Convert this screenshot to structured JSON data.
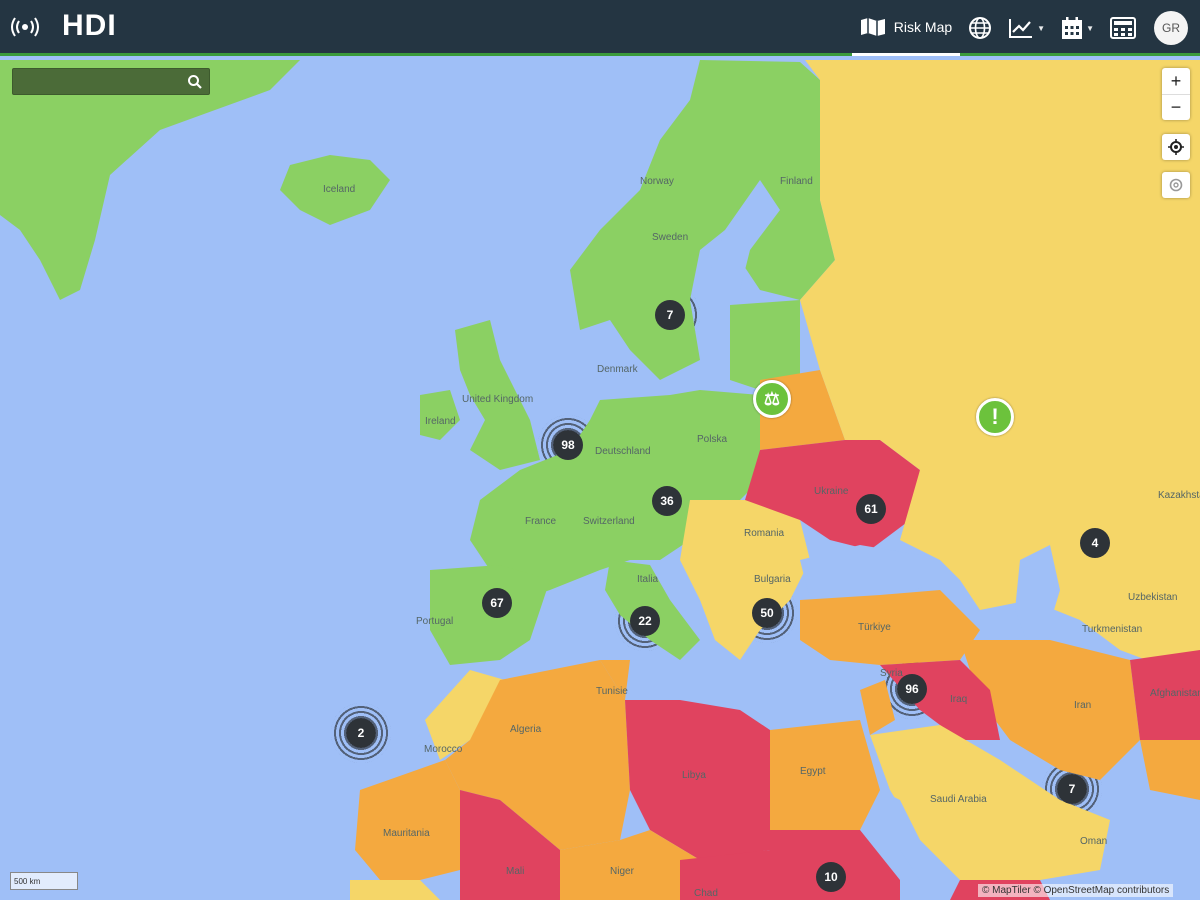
{
  "header": {
    "logo": "HDI",
    "nav": [
      {
        "id": "risk-map",
        "label": "Risk Map",
        "icon": "map-icon",
        "active": true
      },
      {
        "id": "globe",
        "label": "",
        "icon": "globe-icon"
      },
      {
        "id": "charts",
        "label": "",
        "icon": "line-chart-icon",
        "dropdown": true
      },
      {
        "id": "calendar",
        "label": "",
        "icon": "calendar-icon",
        "dropdown": true
      },
      {
        "id": "calculator",
        "label": "",
        "icon": "calculator-icon"
      }
    ],
    "user_initials": "GR"
  },
  "search": {
    "placeholder": "",
    "value": ""
  },
  "controls": {
    "zoom_in": "+",
    "zoom_out": "−"
  },
  "map": {
    "legend_colors": {
      "green": "#8bd063",
      "yellow": "#f5d668",
      "orange": "#f4a93f",
      "red": "#e0435f",
      "water": "#9fbff7"
    },
    "country_labels": [
      {
        "name": "Iceland"
      },
      {
        "name": "Norway"
      },
      {
        "name": "Sweden"
      },
      {
        "name": "Finland"
      },
      {
        "name": "Denmark"
      },
      {
        "name": "United Kingdom"
      },
      {
        "name": "Ireland"
      },
      {
        "name": "Deutschland"
      },
      {
        "name": "Polska"
      },
      {
        "name": "France"
      },
      {
        "name": "Switzerland"
      },
      {
        "name": "Portugal"
      },
      {
        "name": "Italia"
      },
      {
        "name": "Romania"
      },
      {
        "name": "Ukraine"
      },
      {
        "name": "Bulgaria"
      },
      {
        "name": "Türkiye"
      },
      {
        "name": "Tunisie"
      },
      {
        "name": "Algeria"
      },
      {
        "name": "Libya"
      },
      {
        "name": "Egypt"
      },
      {
        "name": "Morocco"
      },
      {
        "name": "Mauritania"
      },
      {
        "name": "Mali"
      },
      {
        "name": "Niger"
      },
      {
        "name": "Chad"
      },
      {
        "name": "Saudi Arabia"
      },
      {
        "name": "Iraq"
      },
      {
        "name": "Iran"
      },
      {
        "name": "Afghanistan"
      },
      {
        "name": "Kazakhstan"
      },
      {
        "name": "Uzbekistan"
      },
      {
        "name": "Turkmenistan"
      },
      {
        "name": "Oman"
      },
      {
        "name": "Syria"
      }
    ],
    "clusters": [
      {
        "count": "7"
      },
      {
        "count": "98"
      },
      {
        "count": "36"
      },
      {
        "count": "61"
      },
      {
        "count": "4"
      },
      {
        "count": "67"
      },
      {
        "count": "22"
      },
      {
        "count": "50"
      },
      {
        "count": "2"
      },
      {
        "count": "96"
      },
      {
        "count": "7"
      },
      {
        "count": "10"
      }
    ],
    "markers": [
      {
        "type": "scales-icon",
        "symbol": "⚖"
      },
      {
        "type": "alert-icon",
        "symbol": "!"
      }
    ],
    "scale_label": "500 km",
    "attribution": "© MapTiler © OpenStreetMap contributors"
  }
}
